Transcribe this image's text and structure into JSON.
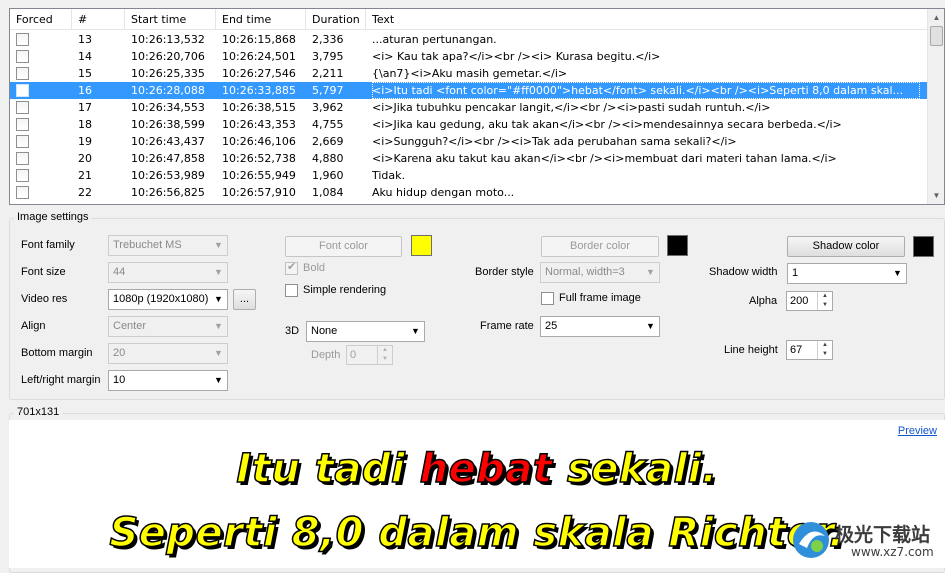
{
  "grid": {
    "columns": [
      "Forced",
      "#",
      "Start time",
      "End time",
      "Duration",
      "Text"
    ],
    "rows": [
      {
        "num": "13",
        "start": "10:26:13,532",
        "end": "10:26:15,868",
        "dur": "2,336",
        "text": "...aturan pertunangan."
      },
      {
        "num": "14",
        "start": "10:26:20,706",
        "end": "10:26:24,501",
        "dur": "3,795",
        "text": "<i> Kau tak apa?</i><br /><i> Kurasa begitu.</i>"
      },
      {
        "num": "15",
        "start": "10:26:25,335",
        "end": "10:26:27,546",
        "dur": "2,211",
        "text": "{\\an7}<i>Aku masih gemetar.</i>"
      },
      {
        "num": "16",
        "start": "10:26:28,088",
        "end": "10:26:33,885",
        "dur": "5,797",
        "text": "<i>Itu tadi <font color=\"#ff0000\">hebat</font> sekali.</i><br /><i>Seperti 8,0 dalam skal..."
      },
      {
        "num": "17",
        "start": "10:26:34,553",
        "end": "10:26:38,515",
        "dur": "3,962",
        "text": "<i>Jika tubuhku pencakar langit,</i><br /><i>pasti sudah runtuh.</i>"
      },
      {
        "num": "18",
        "start": "10:26:38,599",
        "end": "10:26:43,353",
        "dur": "4,755",
        "text": "<i>Jika kau gedung, aku tak akan</i><br /><i>mendesainnya secara berbeda.</i>"
      },
      {
        "num": "19",
        "start": "10:26:43,437",
        "end": "10:26:46,106",
        "dur": "2,669",
        "text": "<i>Sungguh?</i><br /><i>Tak ada perubahan sama sekali?</i>"
      },
      {
        "num": "20",
        "start": "10:26:47,858",
        "end": "10:26:52,738",
        "dur": "4,880",
        "text": "<i>Karena aku takut kau akan</i><br /><i>membuat dari materi tahan lama.</i>"
      },
      {
        "num": "21",
        "start": "10:26:53,989",
        "end": "10:26:55,949",
        "dur": "1,960",
        "text": "Tidak."
      },
      {
        "num": "22",
        "start": "10:26:56,825",
        "end": "10:26:57,910",
        "dur": "1,084",
        "text": "Aku hidup dengan moto..."
      }
    ],
    "selected_index": 3
  },
  "image_settings": {
    "title": "Image settings",
    "font_family_label": "Font family",
    "font_family_value": "Trebuchet MS",
    "font_size_label": "Font size",
    "font_size_value": "44",
    "video_res_label": "Video res",
    "video_res_value": "1080p (1920x1080)",
    "video_res_browse": "...",
    "align_label": "Align",
    "align_value": "Center",
    "bottom_margin_label": "Bottom margin",
    "bottom_margin_value": "20",
    "lr_margin_label": "Left/right margin",
    "lr_margin_value": "10",
    "font_color_button": "Font color",
    "font_color": "#ffff00",
    "bold_label": "Bold",
    "bold_checked": true,
    "simple_rendering_label": "Simple rendering",
    "three_d_label": "3D",
    "three_d_value": "None",
    "depth_label": "Depth",
    "depth_value": "0",
    "border_color_button": "Border color",
    "border_color": "#000000",
    "border_style_label": "Border style",
    "border_style_value": "Normal, width=3",
    "full_frame_label": "Full frame image",
    "frame_rate_label": "Frame rate",
    "frame_rate_value": "25",
    "shadow_color_button": "Shadow color",
    "shadow_color": "#000000",
    "shadow_width_label": "Shadow width",
    "shadow_width_value": "1",
    "alpha_label": "Alpha",
    "alpha_value": "200",
    "line_height_label": "Line height",
    "line_height_value": "67"
  },
  "preview": {
    "size_label": "701x131",
    "link": "Preview",
    "line1_before": "Itu tadi ",
    "line1_red": "hebat",
    "line1_after": " sekali.",
    "line2": "Seperti 8,0 dalam skala Richter.",
    "highlight_color": "#ff0000"
  },
  "watermark": {
    "line1": "极光下载站",
    "line2": "www.xz7.com"
  }
}
